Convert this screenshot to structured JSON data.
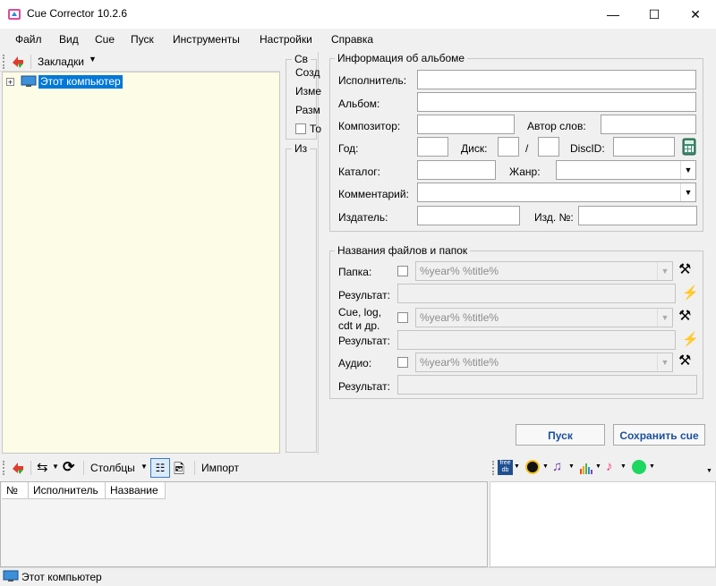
{
  "window": {
    "title": "Cue Corrector 10.2.6"
  },
  "menu": [
    "Файл",
    "Вид",
    "Cue",
    "Пуск",
    "Инструменты",
    "Настройки",
    "Справка"
  ],
  "left_panel": {
    "bookmarks_label": "Закладки",
    "tree_root": "Этот компьютер"
  },
  "props_panel": {
    "title": "Св",
    "lines": [
      "Созд",
      "Изме",
      "Разм"
    ],
    "checkbox_label": "То",
    "title2": "Из"
  },
  "album": {
    "group_title": "Информация об альбоме",
    "performer": "Исполнитель:",
    "album": "Альбом:",
    "composer": "Композитор:",
    "lyricist": "Автор слов:",
    "year": "Год:",
    "disc": "Диск:",
    "slash": "/",
    "discid": "DiscID:",
    "catalog": "Каталог:",
    "genre": "Жанр:",
    "comment": "Комментарий:",
    "publisher": "Издатель:",
    "pub_no": "Изд. №:"
  },
  "files": {
    "group_title": "Названия файлов и папок",
    "folder": "Папка:",
    "result": "Результат:",
    "cue_line1": "Cue, log,",
    "cue_line2": "cdt и др.",
    "audio": "Аудио:",
    "pattern": "%year% %title%"
  },
  "buttons": {
    "run": "Пуск",
    "save_cue": "Сохранить cue"
  },
  "bottom_toolbar": {
    "columns": "Столбцы",
    "import": "Импорт"
  },
  "table": {
    "columns": [
      "№",
      "Исполнитель",
      "Название"
    ]
  },
  "status": {
    "text": "Этот компьютер"
  },
  "colors": {
    "selection": "#0078d7",
    "tree_bg": "#fdfce6",
    "button_text": "#1b4f9c"
  }
}
